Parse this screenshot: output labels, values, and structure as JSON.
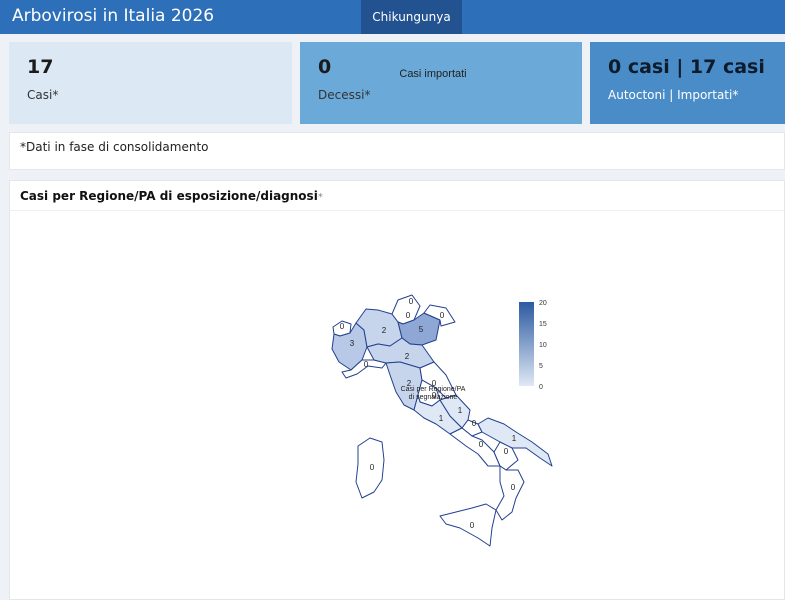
{
  "app": {
    "title": "Arbovirosi in Italia 2026",
    "tabs": [
      {
        "label": "Chikungunya",
        "active": true
      }
    ]
  },
  "cards": [
    {
      "value": "17",
      "label": "Casi*",
      "color": "#dce8f4"
    },
    {
      "value": "0",
      "label": "Decessi*",
      "color": "#6aa9d8"
    },
    {
      "value": "0 casi | 17 casi",
      "label": "Autoctoni | Importati*",
      "color": "#4a8cc8"
    }
  ],
  "note": "*Dati in fase di consolidamento",
  "panel": {
    "title": "Casi per Regione/PA di esposizione/diagnosi",
    "asterisk": "*"
  },
  "map": {
    "title": "Casi importati",
    "legend": {
      "ticks": [
        "20",
        "15",
        "10",
        "5",
        "0"
      ],
      "low_color": "#dfe8f5",
      "high_color": "#2c5aa0"
    },
    "caption_line1": "Casi per Regione/PA",
    "caption_line2": "di segnalazione",
    "regions": [
      {
        "value": "0"
      },
      {
        "value": "0"
      },
      {
        "value": "0"
      },
      {
        "value": "0"
      },
      {
        "value": "2"
      },
      {
        "value": "5"
      },
      {
        "value": "3"
      },
      {
        "value": "2"
      },
      {
        "value": "0"
      },
      {
        "value": "2"
      },
      {
        "value": "0"
      },
      {
        "value": "0"
      },
      {
        "value": "1"
      },
      {
        "value": "1"
      },
      {
        "value": "0"
      },
      {
        "value": "0"
      },
      {
        "value": "1"
      },
      {
        "value": "0"
      },
      {
        "value": "0"
      },
      {
        "value": "0"
      },
      {
        "value": "0"
      }
    ]
  }
}
